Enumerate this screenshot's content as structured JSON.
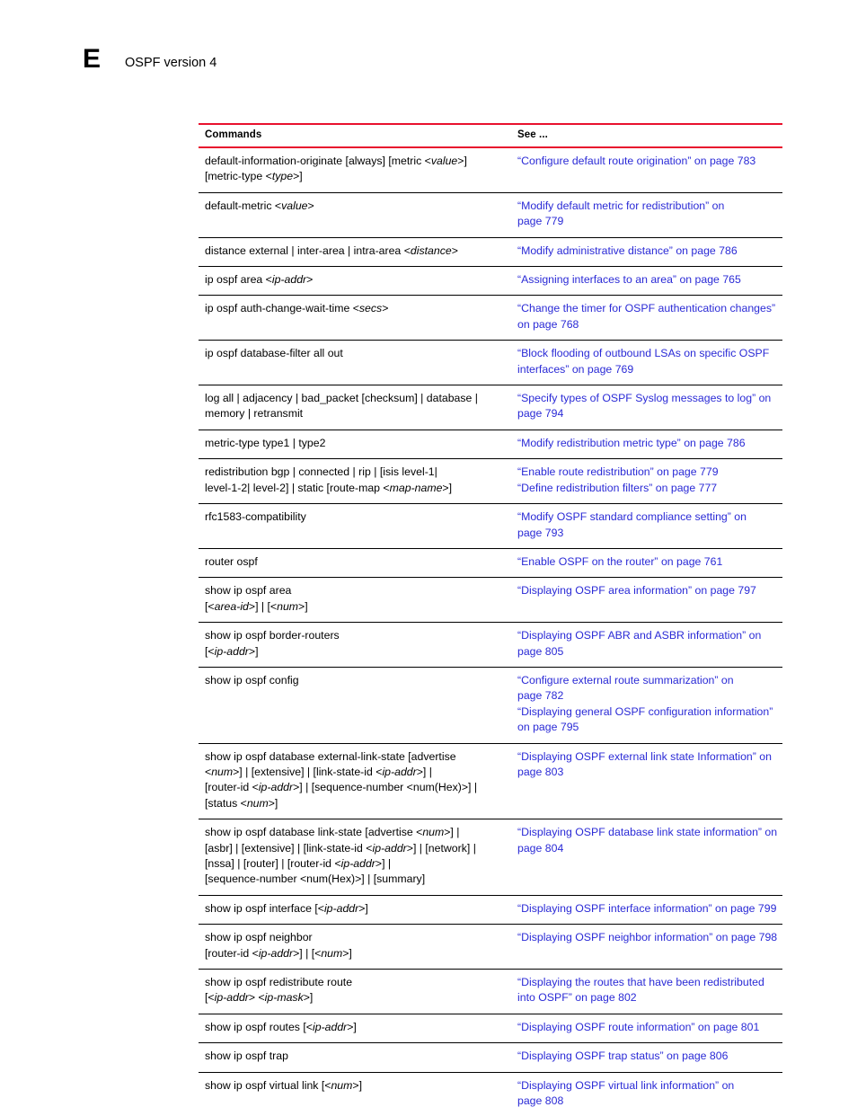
{
  "page": {
    "chapter_letter": "E",
    "header_title": "OSPF version 4"
  },
  "table": {
    "columns": {
      "commands": "Commands",
      "see": "See ..."
    },
    "accent_color": "#e8112d",
    "link_color": "#2a2ad6",
    "rows": [
      {
        "command": "default-information-originate [always] [metric <value>]\n[metric-type <type>]",
        "command_html": "default-information-originate [always] [metric &lt;<i>value</i>&gt;]\n[metric-type &lt;<i>type</i>&gt;]",
        "links": [
          "“Configure default route origination” on page 783"
        ]
      },
      {
        "command": "default-metric <value>",
        "command_html": "default-metric &lt;<i>value</i>&gt;",
        "links": [
          "“Modify default metric for redistribution” on\npage 779"
        ]
      },
      {
        "command": "distance external | inter-area | intra-area <distance>",
        "command_html": "distance external | inter-area | intra-area &lt;<i>distance</i>&gt;",
        "links": [
          "“Modify administrative distance” on page 786"
        ]
      },
      {
        "command": "ip ospf area <ip-addr>",
        "command_html": "ip ospf area &lt;<i>ip-addr</i>&gt;",
        "links": [
          "“Assigning interfaces to an area” on page 765"
        ]
      },
      {
        "command": "ip ospf auth-change-wait-time <secs>",
        "command_html": "ip ospf auth-change-wait-time &lt;<i>secs</i>&gt;",
        "links": [
          "“Change the timer for OSPF authentication changes”\non page 768"
        ]
      },
      {
        "command": "ip ospf database-filter all out",
        "command_html": "ip ospf database-filter all out",
        "links": [
          "“Block flooding of outbound LSAs on specific OSPF\ninterfaces” on page 769"
        ]
      },
      {
        "command": "log all | adjacency | bad_packet [checksum] | database |\nmemory | retransmit",
        "command_html": "log all | adjacency | bad_packet [checksum] | database |\nmemory | retransmit",
        "links": [
          "“Specify types of OSPF Syslog messages to log” on\npage 794"
        ]
      },
      {
        "command": "metric-type type1 | type2",
        "command_html": "metric-type type1 | type2",
        "links": [
          "“Modify redistribution metric type” on page 786"
        ]
      },
      {
        "command": "redistribution bgp | connected | rip | [isis level-1|\nlevel-1-2| level-2] | static [route-map <map-name>]",
        "command_html": "redistribution bgp | connected | rip | [isis level-1|\nlevel-1-2| level-2] | static [route-map &lt;<i>map-name</i>&gt;]",
        "links": [
          "“Enable route redistribution” on page 779",
          "“Define redistribution filters” on page 777"
        ]
      },
      {
        "command": "rfc1583-compatibility",
        "command_html": "rfc1583-compatibility",
        "links": [
          "“Modify OSPF standard compliance setting” on\npage 793"
        ]
      },
      {
        "command": "router ospf",
        "command_html": "router ospf",
        "links": [
          "“Enable OSPF on the router” on page 761"
        ]
      },
      {
        "command": "show ip ospf area\n[<area-id>] | [<num>]",
        "command_html": "show ip ospf area\n[&lt;<i>area-id</i>&gt;] | [&lt;<i>num</i>&gt;]",
        "links": [
          "“Displaying OSPF area information” on page 797"
        ]
      },
      {
        "command": "show ip ospf border-routers\n[<ip-addr>]",
        "command_html": "show ip ospf border-routers\n[&lt;<i>ip-addr</i>&gt;]",
        "links": [
          "“Displaying OSPF ABR and ASBR information” on\npage 805"
        ]
      },
      {
        "command": "show ip ospf config",
        "command_html": "show ip ospf config",
        "links": [
          "“Configure external route summarization” on\npage 782",
          "“Displaying general OSPF configuration information”\non page 795"
        ]
      },
      {
        "command": "show ip ospf database external-link-state [advertise\n<num>] | [extensive] | [link-state-id <ip-addr>] |\n[router-id <ip-addr>] | [sequence-number <num(Hex)>] |\n[status <num>]",
        "command_html": "show ip ospf database external-link-state [advertise\n&lt;<i>num</i>&gt;] | [extensive] | [link-state-id &lt;<i>ip-addr</i>&gt;] |\n[router-id &lt;<i>ip-addr</i>&gt;] | [sequence-number &lt;num(Hex)&gt;] |\n[status &lt;<i>num</i>&gt;]",
        "links": [
          "“Displaying OSPF external link state Information” on\npage 803"
        ]
      },
      {
        "command": "show ip ospf database link-state [advertise <num>] |\n[asbr] | [extensive] | [link-state-id <ip-addr>] | [network] |\n[nssa] | [router] | [router-id <ip-addr>] |\n[sequence-number <num(Hex)>] | [summary]",
        "command_html": "show ip ospf database link-state [advertise &lt;<i>num</i>&gt;] |\n[asbr] | [extensive] | [link-state-id &lt;<i>ip-addr</i>&gt;] | [network] |\n[nssa] | [router] | [router-id &lt;<i>ip-addr</i>&gt;] |\n[sequence-number &lt;num(Hex)&gt;] | [summary]",
        "links": [
          "“Displaying OSPF database link state information” on\npage 804"
        ]
      },
      {
        "command": "show ip ospf interface [<ip-addr>]",
        "command_html": "show ip ospf interface [&lt;<i>ip-addr</i>&gt;]",
        "links": [
          "“Displaying OSPF interface information” on page 799"
        ]
      },
      {
        "command": "show ip ospf neighbor\n[router-id <ip-addr>] | [<num>]",
        "command_html": "show ip ospf neighbor\n[router-id &lt;<i>ip-addr</i>&gt;] | [&lt;<i>num</i>&gt;]",
        "links": [
          "“Displaying OSPF neighbor information” on page 798"
        ]
      },
      {
        "command": "show ip ospf redistribute route\n[<ip-addr> <ip-mask>]",
        "command_html": "show ip ospf redistribute route\n[&lt;<i>ip-addr</i>&gt; &lt;<i>ip-mask</i>&gt;]",
        "links": [
          "“Displaying the routes that have been redistributed\ninto OSPF” on page 802"
        ]
      },
      {
        "command": "show ip ospf routes [<ip-addr>]",
        "command_html": "show ip ospf routes [&lt;<i>ip-addr</i>&gt;]",
        "links": [
          "“Displaying OSPF route information” on page 801"
        ]
      },
      {
        "command": "show ip ospf trap",
        "command_html": "show ip ospf trap",
        "links": [
          "“Displaying OSPF trap status” on page 806"
        ]
      },
      {
        "command": "show ip ospf virtual link [<num>]",
        "command_html": "show ip ospf virtual link [&lt;<i>num</i>&gt;]",
        "links": [
          "“Displaying OSPF virtual link information” on\npage 808"
        ]
      }
    ]
  }
}
